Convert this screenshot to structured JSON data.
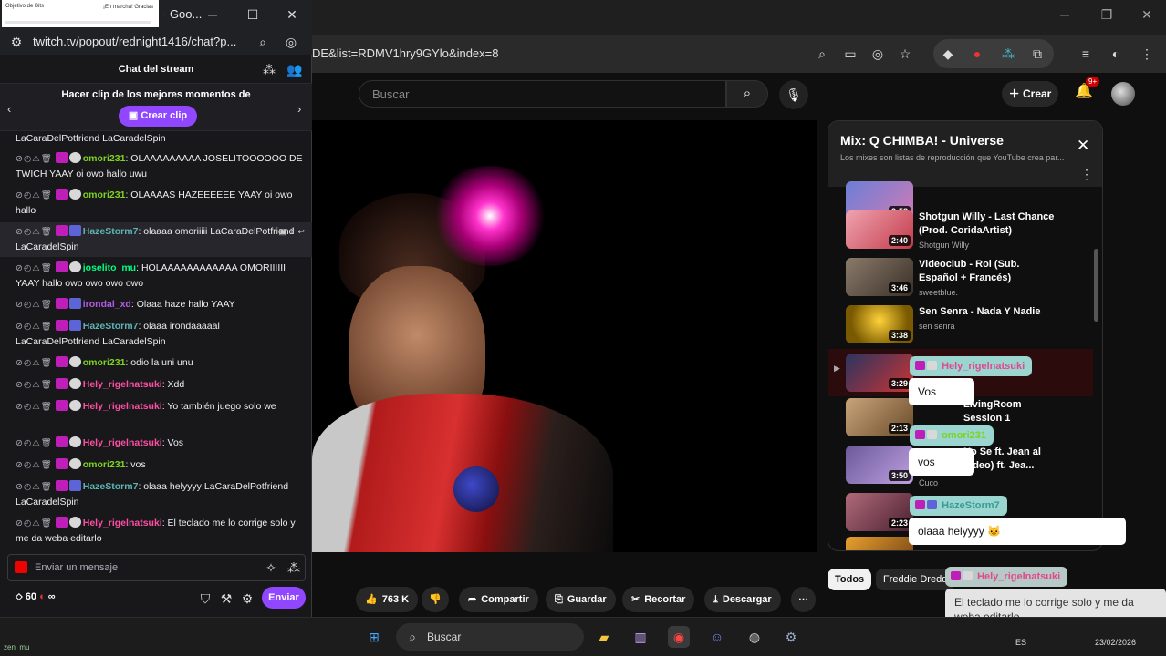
{
  "twitch": {
    "tab_title": "- Goo...",
    "tab_thumb_left": "Objetivo de Bits",
    "tab_thumb_right": "¡En marcha! Gracias",
    "url": "twitch.tv/popout/rednight1416/chat?p...",
    "chat_title": "Chat del stream",
    "clip_text": "Hacer clip de los mejores momentos de",
    "clip_button": "Crear clip",
    "input_placeholder": "Enviar un mensaje",
    "points": "60",
    "points_extra": "∞",
    "send_button": "Enviar",
    "messages": [
      {
        "user": "",
        "color": "#efeff1",
        "text": "LaCaraDelPotfriend LaCaradelSpin"
      },
      {
        "user": "omori231",
        "color": "#7ed321",
        "text": ": OLAAAAAAAAA JOSELITOOOOOO DE TWICH YAAY oi owo hallo uwu"
      },
      {
        "user": "omori231",
        "color": "#7ed321",
        "text": ": OLAAAAS HAZEEEEEE YAAY oi owo hallo"
      },
      {
        "user": "HazeStorm7",
        "color": "#5fb3b3",
        "text": ": olaaaa omoriiiii LaCaraDelPotfriend LaCaradelSpin"
      },
      {
        "user": "joselito_mu",
        "color": "#00ff7f",
        "text": ": HOLAAAAAAAAAAAA OMORIIIIII YAAY hallo owo owo owo owo"
      },
      {
        "user": "irondal_xd",
        "color": "#b05ce6",
        "text": ": Olaaa haze hallo YAAY"
      },
      {
        "user": "HazeStorm7",
        "color": "#5fb3b3",
        "text": ": olaaa irondaaaaal LaCaraDelPotfriend LaCaradelSpin"
      },
      {
        "user": "omori231",
        "color": "#7ed321",
        "text": ": odio la uni unu"
      },
      {
        "user": "Hely_rigelnatsuki",
        "color": "#ff4fa3",
        "text": ": Xdd"
      },
      {
        "user": "Hely_rigelnatsuki",
        "color": "#ff4fa3",
        "text": ": Yo también juego solo we"
      },
      {
        "user": "Hely_rigelnatsuki",
        "color": "#ff4fa3",
        "text": ": Vos"
      },
      {
        "user": "omori231",
        "color": "#7ed321",
        "text": ": vos"
      },
      {
        "user": "HazeStorm7",
        "color": "#5fb3b3",
        "text": ": olaaa helyyyy LaCaraDelPotfriend LaCaradelSpin"
      },
      {
        "user": "Hely_rigelnatsuki",
        "color": "#ff4fa3",
        "text": ": El teclado me lo corrige solo y me da weba editarlo"
      }
    ]
  },
  "browser": {
    "url": "DE&list=RDMV1hry9GYlo&index=8"
  },
  "youtube": {
    "search_placeholder": "Buscar",
    "create_label": "Crear",
    "notif_badge": "9+",
    "playlist_title": "Mix: Q CHIMBA! - Universe",
    "playlist_sub": "Los mixes son listas de reproducción que YouTube crea par...",
    "playlist_items": [
      {
        "title": "",
        "channel": "",
        "duration": "2:58"
      },
      {
        "title": "Shotgun Willy - Last Chance (Prod. CoridaArtist)",
        "channel": "Shotgun Willy",
        "duration": "2:40"
      },
      {
        "title": "Videoclub - Roi (Sub. Español + Francés)",
        "channel": "sweetblue.",
        "duration": "3:46"
      },
      {
        "title": "Sen Senra - Nada Y Nadie",
        "channel": "sen senra",
        "duration": "3:38"
      },
      {
        "title": "",
        "channel": "",
        "duration": "3:29"
      },
      {
        "title": "LivingRoom Session 1",
        "channel": "",
        "duration": "2:13"
      },
      {
        "title": "No Se ft. Jean al Video) ft. Jea...",
        "channel": "Cuco",
        "duration": "3:50"
      },
      {
        "title": "",
        "channel": "",
        "duration": "2:23"
      }
    ],
    "chips": [
      "Todos",
      "Freddie Dredd"
    ],
    "actions": {
      "likes": "763 K",
      "share": "Compartir",
      "save": "Guardar",
      "clip": "Recortar",
      "download": "Descargar"
    }
  },
  "overlay": [
    {
      "user": "Hely_rigelnatsuki",
      "color": "#5fd0c8",
      "text": "Vos"
    },
    {
      "user": "omori231",
      "color": "#5fd0c8",
      "text": "vos"
    },
    {
      "user": "HazeStorm7",
      "color": "#5fd0c8",
      "text": "olaaa helyyyy"
    },
    {
      "user": "Hely_rigelnatsuki",
      "color": "#e6e6e6",
      "text": "El teclado me lo corrige solo y me da weba editarlo"
    }
  ],
  "taskbar": {
    "search": "Buscar",
    "lang": "ES",
    "date": "23/02/2026",
    "status_user": "zen_mu"
  }
}
